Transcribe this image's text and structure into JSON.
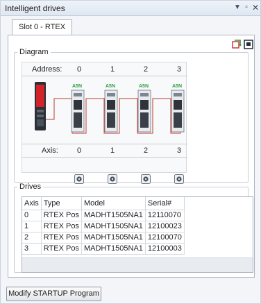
{
  "window": {
    "title": "Intelligent drives"
  },
  "tabs": [
    {
      "label": "Slot 0 - RTEX"
    }
  ],
  "toolbar": {
    "icons": [
      "refresh-icon",
      "window-icon"
    ]
  },
  "diagram": {
    "group_label": "Diagram",
    "address_label": "Address:",
    "axis_label": "Axis:",
    "addresses": [
      "0",
      "1",
      "2",
      "3"
    ],
    "axes": [
      "0",
      "1",
      "2",
      "3"
    ],
    "drive_badge": "A5N",
    "colors": {
      "controller": "#d2232a",
      "link": "#c0392b",
      "drive_badge": "#2f9e44"
    }
  },
  "drives": {
    "group_label": "Drives",
    "columns": [
      "Axis",
      "Type",
      "Model",
      "Serial#"
    ],
    "rows": [
      [
        "0",
        "RTEX Pos",
        "MADHT1505NA1",
        "12110070"
      ],
      [
        "1",
        "RTEX Pos",
        "MADHT1505NA1",
        "12100023"
      ],
      [
        "2",
        "RTEX Pos",
        "MADHT1505NA1",
        "12100070"
      ],
      [
        "3",
        "RTEX Pos",
        "MADHT1505NA1",
        "12100003"
      ]
    ]
  },
  "actions": {
    "modify_startup": "Modify STARTUP Program"
  }
}
